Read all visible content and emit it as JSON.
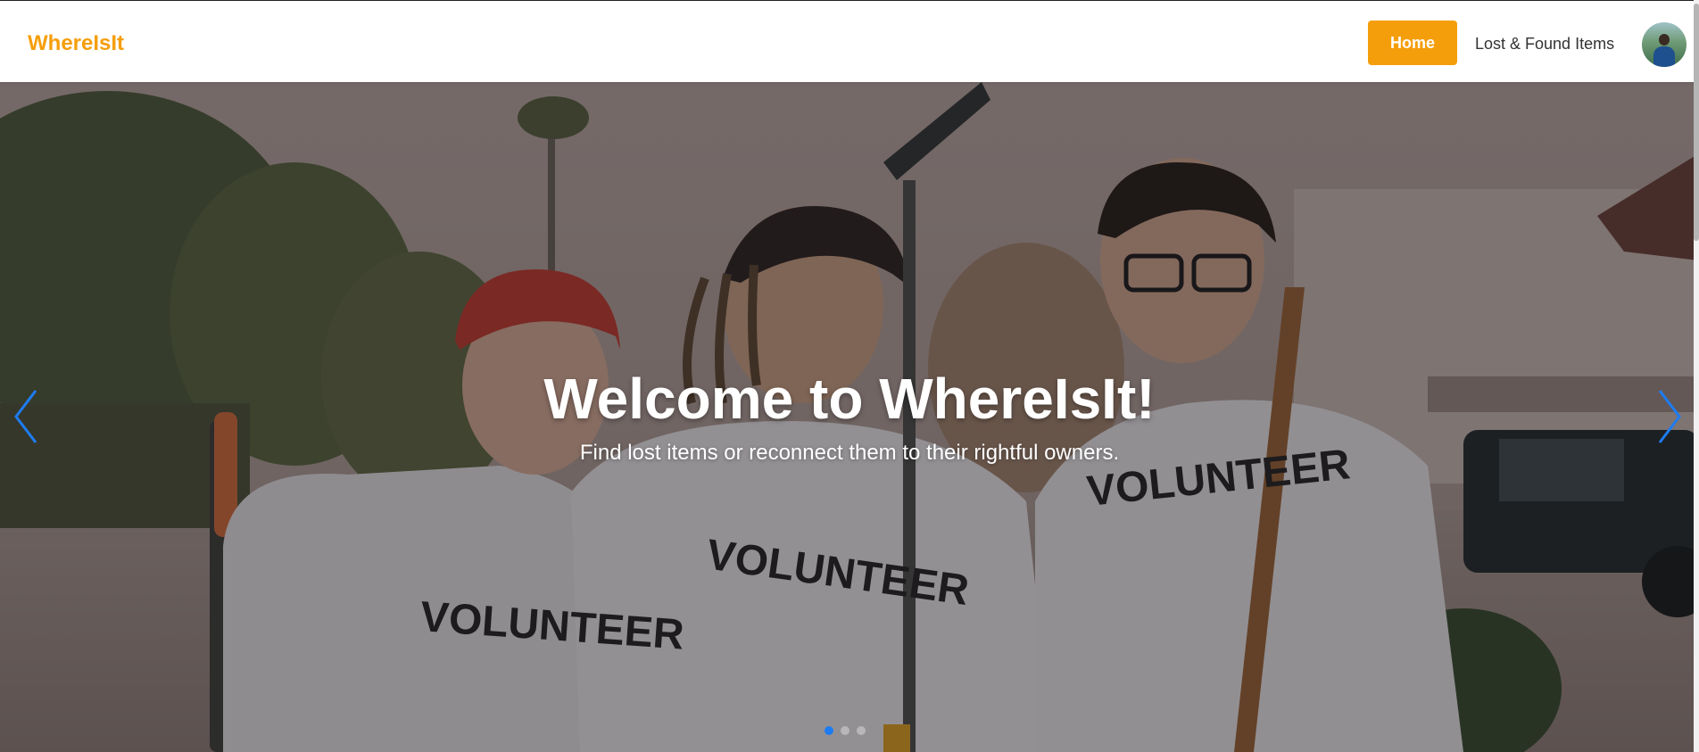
{
  "navbar": {
    "brand": "WhereIsIt",
    "home_label": "Home",
    "lost_found_label": "Lost & Found Items"
  },
  "hero": {
    "title": "Welcome to WhereIsIt!",
    "subtitle": "Find lost items or reconnect them to their rightful owners.",
    "slide_count": 3,
    "active_slide": 1,
    "shirt_text": "VOLUNTEER"
  },
  "colors": {
    "brand": "#f59e0b",
    "arrow": "#1e7cf2",
    "active_dot": "#1e7cf2"
  },
  "icons": {
    "prev": "chevron-left-icon",
    "next": "chevron-right-icon"
  }
}
